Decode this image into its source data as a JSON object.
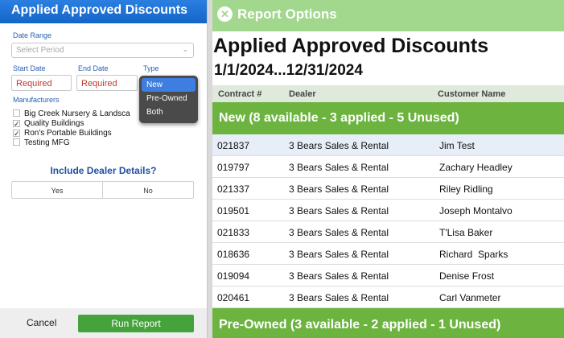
{
  "left_panel": {
    "header": "Applied Approved Discounts",
    "date_range_label": "Date Range",
    "date_range_placeholder": "Select Period",
    "start_date_label": "Start Date",
    "end_date_label": "End Date",
    "type_label": "Type",
    "start_date_value": "Required",
    "end_date_value": "Required",
    "type_options": [
      "New",
      "Pre-Owned",
      "Both"
    ],
    "type_selected": "New",
    "manufacturers_label": "Manufacturers",
    "manufacturers": [
      {
        "name": "Big Creek Nursery & Landsca",
        "checked": false
      },
      {
        "name": "Quality Buildings",
        "checked": true
      },
      {
        "name": "Ron's Portable Buildings",
        "checked": true
      },
      {
        "name": "Testing MFG",
        "checked": false
      }
    ],
    "include_title": "Include Dealer Details?",
    "yes_label": "Yes",
    "no_label": "No",
    "cancel_label": "Cancel",
    "run_label": "Run Report",
    "accent_color": "#1565c8",
    "run_color": "#45a33b"
  },
  "report": {
    "options_label": "Report Options",
    "title": "Applied Approved Discounts",
    "dates": "1/1/2024...12/31/2024",
    "columns": [
      "Contract #",
      "Dealer",
      "Customer Name"
    ],
    "groups": [
      {
        "label": "New (8 available - 3 applied - 5 Unused)",
        "rows": [
          {
            "contract": "021837",
            "dealer": "3 Bears Sales & Rental",
            "customer": "Jim Test"
          },
          {
            "contract": "019797",
            "dealer": "3 Bears Sales & Rental",
            "customer": "Zachary Headley"
          },
          {
            "contract": "021337",
            "dealer": "3 Bears Sales & Rental",
            "customer": "Riley Ridling"
          },
          {
            "contract": "019501",
            "dealer": "3 Bears Sales & Rental",
            "customer": "Joseph Montalvo"
          },
          {
            "contract": "021833",
            "dealer": "3 Bears Sales & Rental",
            "customer": "T'Lisa Baker"
          },
          {
            "contract": "018636",
            "dealer": "3 Bears Sales & Rental",
            "customer": "Richard  Sparks"
          },
          {
            "contract": "019094",
            "dealer": "3 Bears Sales & Rental",
            "customer": "Denise Frost"
          },
          {
            "contract": "020461",
            "dealer": "3 Bears Sales & Rental",
            "customer": "Carl Vanmeter"
          }
        ]
      },
      {
        "label": "Pre-Owned (3 available - 2 applied - 1 Unused)",
        "rows": []
      }
    ],
    "band_color": "#6cb43f",
    "options_color": "#a1d88d"
  }
}
